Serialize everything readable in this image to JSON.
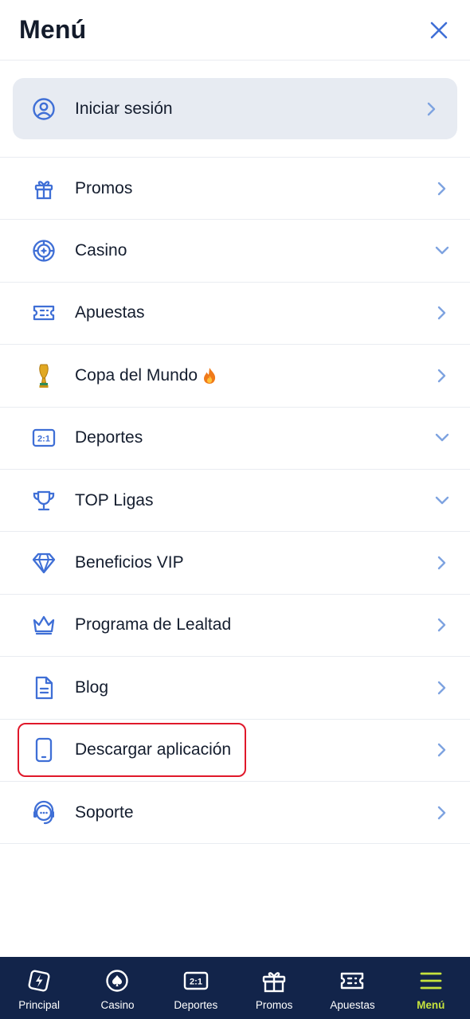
{
  "header": {
    "title": "Menú"
  },
  "login": {
    "label": "Iniciar sesión"
  },
  "menu": [
    {
      "label": "Promos",
      "icon": "gift-icon",
      "chevron": "right"
    },
    {
      "label": "Casino",
      "icon": "roulette-icon",
      "chevron": "down"
    },
    {
      "label": "Apuestas",
      "icon": "ticket-icon",
      "chevron": "right"
    },
    {
      "label": "Copa del Mundo",
      "icon": "world-cup-trophy-icon",
      "chevron": "right",
      "extra_icon": "fire-icon"
    },
    {
      "label": "Deportes",
      "icon": "scoreboard-icon",
      "chevron": "down"
    },
    {
      "label": "TOP Ligas",
      "icon": "trophy-icon",
      "chevron": "down"
    },
    {
      "label": "Beneficios VIP",
      "icon": "diamond-icon",
      "chevron": "right"
    },
    {
      "label": "Programa de Lealtad",
      "icon": "crown-icon",
      "chevron": "right"
    },
    {
      "label": "Blog",
      "icon": "document-icon",
      "chevron": "right"
    },
    {
      "label": "Descargar aplicación",
      "icon": "phone-icon",
      "chevron": "right"
    },
    {
      "label": "Soporte",
      "icon": "headset-icon",
      "chevron": "right"
    }
  ],
  "tabs": [
    {
      "label": "Principal",
      "icon": "lightning-card-icon"
    },
    {
      "label": "Casino",
      "icon": "spade-chip-icon"
    },
    {
      "label": "Deportes",
      "icon": "scoreboard-icon"
    },
    {
      "label": "Promos",
      "icon": "gift-box-icon"
    },
    {
      "label": "Apuestas",
      "icon": "ticket-icon"
    },
    {
      "label": "Menú",
      "icon": "hamburger-icon",
      "active": true
    }
  ],
  "colors": {
    "accent": "#3f6fd6",
    "chevron": "#7ea3e0",
    "tabbar": "#12244a",
    "active_tab": "#c6e33d",
    "highlight": "#e0182a"
  }
}
